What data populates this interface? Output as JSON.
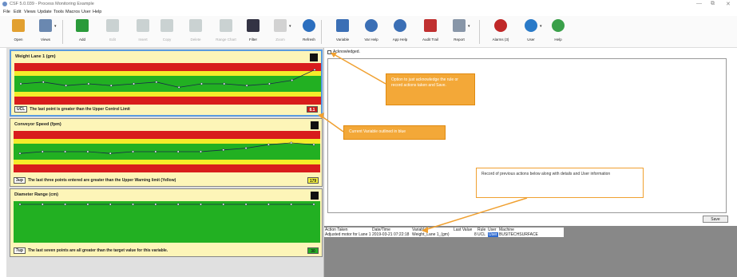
{
  "window": {
    "title": "CSF 5.0.039 - Process Monitoring Example",
    "minimize": "—",
    "restore": "⧉",
    "close": "✕"
  },
  "menu": [
    "File",
    "Edit",
    "Views",
    "Update",
    "Tools",
    "Macros",
    "User",
    "Help"
  ],
  "toolbar": [
    {
      "label": "Open",
      "icon": "folder-open-icon",
      "color": "#e2a030",
      "enabled": true
    },
    {
      "label": "Views",
      "icon": "views-icon",
      "color": "#6a88b0",
      "enabled": true,
      "dropdown": true
    },
    {
      "label": "Add",
      "icon": "add-icon",
      "color": "#2a9a3a",
      "enabled": true
    },
    {
      "label": "Edit",
      "icon": "edit-icon",
      "color": "#9aa",
      "enabled": false
    },
    {
      "label": "Insert",
      "icon": "insert-icon",
      "color": "#9aa",
      "enabled": false
    },
    {
      "label": "Copy",
      "icon": "copy-icon",
      "color": "#9aa",
      "enabled": false
    },
    {
      "label": "Delete",
      "icon": "delete-icon",
      "color": "#9aa",
      "enabled": false
    },
    {
      "label": "Range Chart",
      "icon": "range-chart-icon",
      "color": "#9aa",
      "enabled": false
    },
    {
      "label": "Filter",
      "icon": "filter-icon",
      "color": "#334",
      "enabled": true
    },
    {
      "label": "Zoom",
      "icon": "zoom-icon",
      "color": "#aaa",
      "enabled": false,
      "dropdown": true
    },
    {
      "label": "Refresh",
      "icon": "refresh-icon",
      "color": "#2c6fbf",
      "enabled": true
    },
    {
      "label": "Variable",
      "icon": "variable-icon",
      "color": "#3b6fb5",
      "enabled": true
    },
    {
      "label": "Var Help",
      "icon": "var-help-icon",
      "color": "#3b6fb5",
      "enabled": true
    },
    {
      "label": "App Help",
      "icon": "app-help-icon",
      "color": "#3b6fb5",
      "enabled": true
    },
    {
      "label": "Audit Trail",
      "icon": "audit-trail-icon",
      "color": "#c03030",
      "enabled": true
    },
    {
      "label": "Report",
      "icon": "report-icon",
      "color": "#8896a8",
      "enabled": true,
      "dropdown": true
    },
    {
      "label": "Alarms (3)",
      "icon": "alarm-icon",
      "color": "#c02828",
      "enabled": true
    },
    {
      "label": "User",
      "icon": "user-icon",
      "color": "#2a7ac8",
      "enabled": true,
      "dropdown": true
    },
    {
      "label": "Help",
      "icon": "help-icon",
      "color": "#3aa04a",
      "enabled": true
    }
  ],
  "cards": [
    {
      "title": "Weight Lane 1 (gm)",
      "rule_code": "UCL",
      "rule_text": "The last point is greater than the Upper Control Limit",
      "last_value": "8.1",
      "value_color": "#cc1a1a",
      "value_text_color": "#ffffff",
      "selected": true,
      "series": [
        0.5,
        0.55,
        0.45,
        0.5,
        0.45,
        0.5,
        0.55,
        0.4,
        0.5,
        0.5,
        0.45,
        0.5,
        0.6,
        0.9
      ]
    },
    {
      "title": "Conveyor Speed (fpm)",
      "rule_code": "3up",
      "rule_text": "The last three points entered are greater than the Upper Warning limit (Yellow)",
      "last_value": "179",
      "value_color": "#f5f23a",
      "value_text_color": "#222222",
      "selected": false,
      "series": [
        0.45,
        0.5,
        0.5,
        0.5,
        0.45,
        0.5,
        0.5,
        0.5,
        0.5,
        0.55,
        0.6,
        0.7,
        0.75,
        0.7
      ]
    },
    {
      "title": "Diameter Range (cm)",
      "rule_code": "7up",
      "rule_text": "The last seven points are all greater than the target value for this variable.",
      "last_value": "30",
      "value_color": "#22b022",
      "value_text_color": "#222222",
      "selected": false,
      "series": [
        1,
        1,
        1,
        1,
        1,
        1,
        1,
        1,
        1,
        1,
        1,
        1,
        1,
        1
      ]
    }
  ],
  "acknowledge_label": "Acknowledged.",
  "save_label": "Save",
  "history": {
    "headers": [
      "Action Taken",
      "Date/Time",
      "Variable",
      "Last Value",
      "Rule",
      "User",
      "Machine"
    ],
    "rows": [
      [
        "Adjusted motor for Lane 1",
        "2019-03-21 07:22:18",
        "Weight_Lane 1_(gm)",
        "8",
        "UCL",
        "User",
        "BUSITECHSURFACE"
      ]
    ]
  },
  "callouts": {
    "ack": "Option to just acknowledge the rule or record actions taken and Save.",
    "current": "Current Variable outlined in blue",
    "record": "Record of previous actions below along with details and User information"
  }
}
